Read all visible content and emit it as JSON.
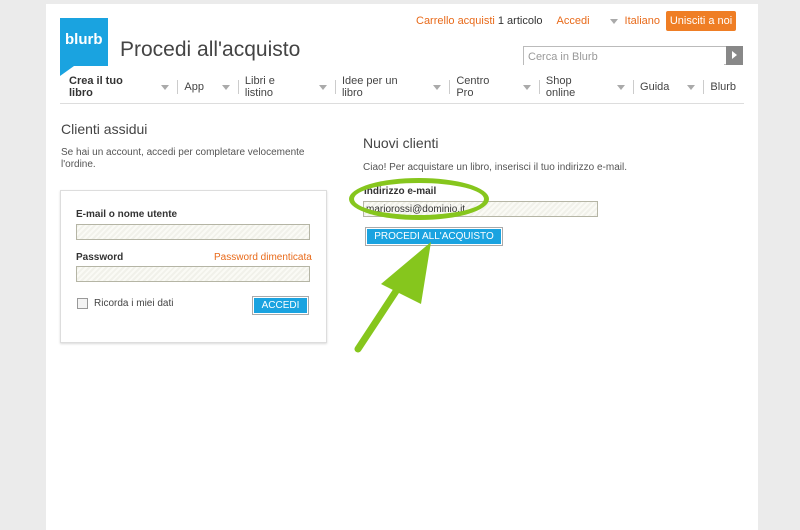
{
  "brand": {
    "logo_text": "blurb"
  },
  "header": {
    "page_title": "Procedi all'acquisto",
    "cart_link": "Carrello acquisti",
    "cart_count": "1 articolo",
    "login_link": "Accedi",
    "language": "Italiano",
    "join_button": "Unisciti a noi",
    "search_placeholder": "Cerca in Blurb"
  },
  "nav": {
    "items": [
      {
        "label": "Crea il tuo libro"
      },
      {
        "label": "App"
      },
      {
        "label": "Libri e listino"
      },
      {
        "label": "Idee per un libro"
      },
      {
        "label": "Centro Pro"
      },
      {
        "label": "Shop online"
      },
      {
        "label": "Guida"
      },
      {
        "label": "Blurb"
      }
    ]
  },
  "returning": {
    "title": "Clienti assidui",
    "description": "Se hai un account, accedi per completare velocemente l'ordine.",
    "email_label": "E-mail o nome utente",
    "email_value": "",
    "password_label": "Password",
    "password_value": "",
    "forgot_link": "Password dimenticata",
    "remember_label": "Ricorda i miei dati",
    "remember_checked": false,
    "login_button": "ACCEDI"
  },
  "new_customer": {
    "title": "Nuovi clienti",
    "description": "Ciao! Per acquistare un libro, inserisci il tuo indirizzo e-mail.",
    "email_label": "Indirizzo e-mail",
    "email_value": "mariorossi@dominio.it",
    "proceed_button": "PROCEDI ALL'ACQUISTO"
  },
  "colors": {
    "accent_blue": "#1aa3e0",
    "link_orange": "#e86a1a",
    "join_orange": "#ef7e25",
    "highlight_green": "#86c61d"
  }
}
